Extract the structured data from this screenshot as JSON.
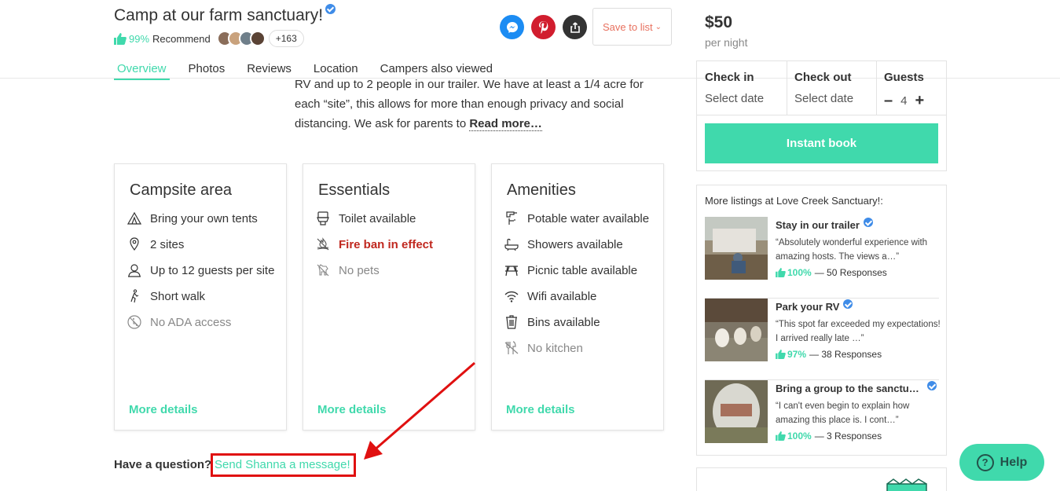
{
  "listing": {
    "title": "Camp at our farm sanctuary!",
    "recommend_pct": "99%",
    "recommend_label": "Recommend",
    "avatars_extra": "+163"
  },
  "actions": {
    "save_label": "Save to list",
    "messenger_icon": "messenger-icon",
    "pinterest_icon": "pinterest-icon",
    "share_icon": "share-icon"
  },
  "tabs": [
    {
      "label": "Overview",
      "active": true
    },
    {
      "label": "Photos"
    },
    {
      "label": "Reviews"
    },
    {
      "label": "Location"
    },
    {
      "label": "Campers also viewed"
    }
  ],
  "description": {
    "text": "RV and up to 2 people in our trailer. We have at least a 1/4 acre for each “site”, this allows for more than enough privacy and social distancing. We ask for parents to ",
    "read_more": "Read more…"
  },
  "cards": {
    "campsite": {
      "title": "Campsite area",
      "items": [
        "Bring your own tents",
        "2 sites",
        "Up to 12 guests per site",
        "Short walk",
        "No ADA access"
      ],
      "more": "More details"
    },
    "essentials": {
      "title": "Essentials",
      "items": [
        "Toilet available",
        "Fire ban in effect",
        "No pets"
      ],
      "more": "More details"
    },
    "amenities": {
      "title": "Amenities",
      "items": [
        "Potable water available",
        "Showers available",
        "Picnic table available",
        "Wifi available",
        "Bins available",
        "No kitchen"
      ],
      "more": "More details"
    }
  },
  "question": {
    "prompt": "Have a question?",
    "link": "Send Shanna a message!"
  },
  "booking": {
    "price": "$50",
    "per": "per night",
    "checkin_label": "Check in",
    "checkin_value": "Select date",
    "checkout_label": "Check out",
    "checkout_value": "Select date",
    "guests_label": "Guests",
    "guests_minus": "–",
    "guests_count": "4",
    "guests_plus": "+",
    "instant_book": "Instant book"
  },
  "more_listings": {
    "title": "More listings at Love Creek Sanctuary!:",
    "items": [
      {
        "title": "Stay in our trailer",
        "quote": "“Absolutely wonderful experience with amazing hosts. The views a…”",
        "pct": "100%",
        "responses": "— 50 Responses"
      },
      {
        "title": "Park your RV",
        "quote": "“This spot far exceeded my expectations! I arrived really late …”",
        "pct": "97%",
        "responses": "— 38 Responses"
      },
      {
        "title": "Bring a group to the sanctu…",
        "quote": "“I can't even begin to explain how amazing this place is. I cont…”",
        "pct": "100%",
        "responses": "— 3 Responses"
      }
    ]
  },
  "help": {
    "label": "Help"
  },
  "colors": {
    "brand": "#40d9ac",
    "ban": "#c0281f",
    "annotation": "#e01010",
    "save": "#e8715f"
  }
}
